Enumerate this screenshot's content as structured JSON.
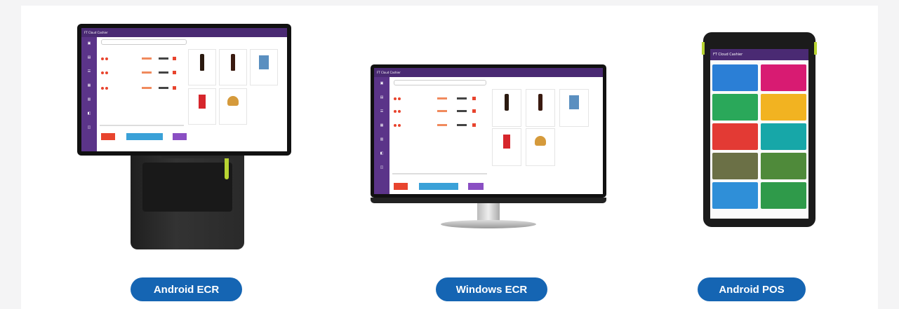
{
  "labels": {
    "android_ecr": "Android ECR",
    "windows_ecr": "Windows ECR",
    "android_pos": "Android POS"
  },
  "colors": {
    "badge": "#1565b3",
    "pos_purple": "#4a2a73",
    "side_purple": "#5b3489"
  }
}
